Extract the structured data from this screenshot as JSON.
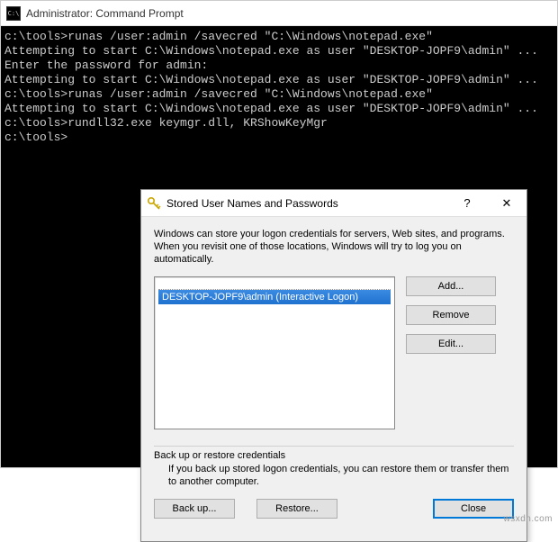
{
  "cmd": {
    "title": "Administrator: Command Prompt",
    "lines": [
      "",
      "c:\\tools>runas /user:admin /savecred \"C:\\Windows\\notepad.exe\"",
      "Attempting to start C:\\Windows\\notepad.exe as user \"DESKTOP-JOPF9\\admin\" ...",
      "Enter the password for admin:",
      "Attempting to start C:\\Windows\\notepad.exe as user \"DESKTOP-JOPF9\\admin\" ...",
      "",
      "c:\\tools>runas /user:admin /savecred \"C:\\Windows\\notepad.exe\"",
      "Attempting to start C:\\Windows\\notepad.exe as user \"DESKTOP-JOPF9\\admin\" ...",
      "",
      "c:\\tools>rundll32.exe keymgr.dll, KRShowKeyMgr",
      "",
      "c:\\tools>"
    ]
  },
  "dialog": {
    "title": "Stored User Names and Passwords",
    "help": "?",
    "close": "✕",
    "intro": "Windows can store your logon credentials for servers, Web sites, and programs. When you revisit one of those locations, Windows will try to log you on automatically.",
    "list": {
      "selected": "DESKTOP-JOPF9\\admin (Interactive Logon)"
    },
    "buttons": {
      "add": "Add...",
      "remove": "Remove",
      "edit": "Edit..."
    },
    "group": {
      "title": "Back up or restore credentials",
      "text": "If you back up stored logon credentials, you can restore them or transfer them to another computer."
    },
    "bottom": {
      "backup": "Back up...",
      "restore": "Restore...",
      "close": "Close"
    }
  },
  "watermark": "wsxdn.com"
}
